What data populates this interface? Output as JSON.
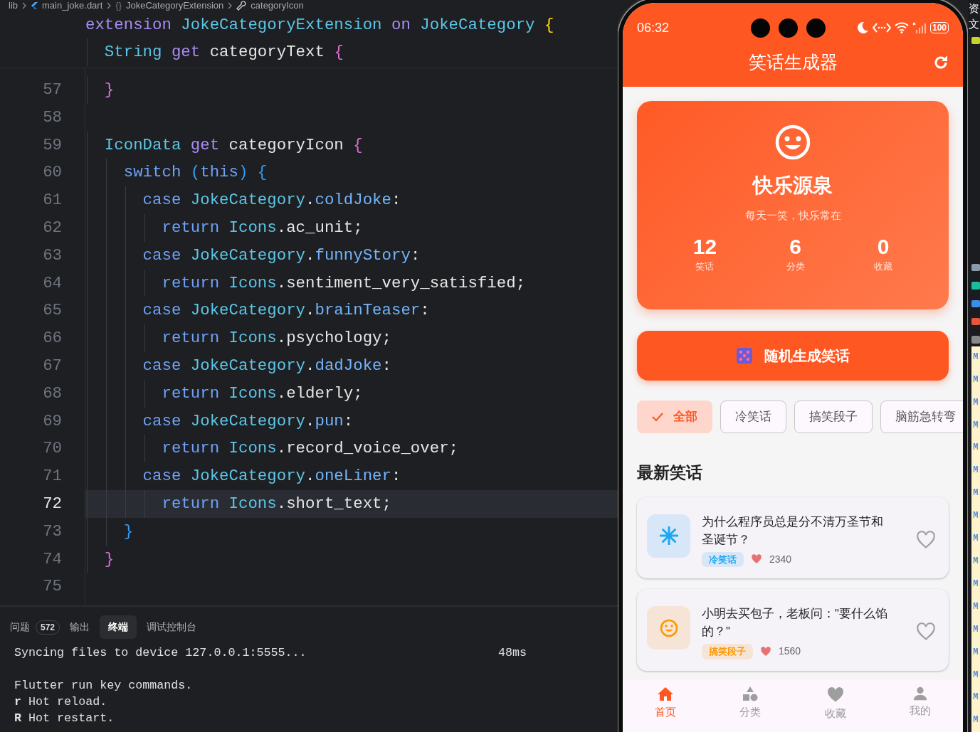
{
  "breadcrumb": [
    {
      "label": "lib"
    },
    {
      "label": "main_joke.dart"
    },
    {
      "label": "JokeCategoryExtension",
      "symbol": "{}"
    },
    {
      "label": "categoryIcon"
    }
  ],
  "sticky_lines": [
    {
      "tokens": [
        {
          "t": "extension",
          "kind": "kw"
        },
        {
          "t": " JokeCategoryExtension ",
          "kind": "type"
        },
        {
          "t": "on",
          "kind": "kw"
        },
        {
          "t": " JokeCategory ",
          "kind": "type"
        },
        {
          "t": "{",
          "kind": "brace1"
        }
      ]
    },
    {
      "tokens": [
        {
          "t": "  String",
          "kind": "type"
        },
        {
          "t": " get",
          "kind": "kw"
        },
        {
          "t": " categoryText ",
          "kind": "ident"
        },
        {
          "t": "{",
          "kind": "brace2"
        }
      ]
    }
  ],
  "code_lines": [
    {
      "number": "57",
      "current": false,
      "tokens": [
        {
          "t": "  }",
          "kind": "brace2"
        }
      ]
    },
    {
      "number": "58",
      "current": false
    },
    {
      "number": "59",
      "current": false,
      "tokens": [
        {
          "t": "  IconData",
          "kind": "type"
        },
        {
          "t": " get",
          "kind": "kw"
        },
        {
          "t": " categoryIcon ",
          "kind": "ident"
        },
        {
          "t": "{",
          "kind": "brace2"
        }
      ]
    },
    {
      "number": "60",
      "current": false,
      "tokens": [
        {
          "t": "    switch ",
          "kind": "ctrl"
        },
        {
          "t": "(",
          "kind": "brace3"
        },
        {
          "t": "this",
          "kind": "ctrl"
        },
        {
          "t": ")",
          "kind": "brace3"
        },
        {
          "t": " {",
          "kind": "brace3"
        }
      ]
    },
    {
      "number": "61",
      "current": false,
      "tokens": [
        {
          "t": "      case",
          "kind": "ctrl"
        },
        {
          "t": " JokeCategory",
          "kind": "type"
        },
        {
          "t": ".",
          "kind": "ident"
        },
        {
          "t": "coldJoke",
          "kind": "prop"
        },
        {
          "t": ":",
          "kind": "ident"
        }
      ]
    },
    {
      "number": "62",
      "current": false,
      "tokens": [
        {
          "t": "        return",
          "kind": "ctrl"
        },
        {
          "t": " Icons",
          "kind": "type"
        },
        {
          "t": ".ac_unit;",
          "kind": "ident"
        }
      ]
    },
    {
      "number": "63",
      "current": false,
      "tokens": [
        {
          "t": "      case",
          "kind": "ctrl"
        },
        {
          "t": " JokeCategory",
          "kind": "type"
        },
        {
          "t": ".",
          "kind": "ident"
        },
        {
          "t": "funnyStory",
          "kind": "prop"
        },
        {
          "t": ":",
          "kind": "ident"
        }
      ]
    },
    {
      "number": "64",
      "current": false,
      "tokens": [
        {
          "t": "        return",
          "kind": "ctrl"
        },
        {
          "t": " Icons",
          "kind": "type"
        },
        {
          "t": ".sentiment_very_satisfied;",
          "kind": "ident"
        }
      ]
    },
    {
      "number": "65",
      "current": false,
      "tokens": [
        {
          "t": "      case",
          "kind": "ctrl"
        },
        {
          "t": " JokeCategory",
          "kind": "type"
        },
        {
          "t": ".",
          "kind": "ident"
        },
        {
          "t": "brainTeaser",
          "kind": "prop"
        },
        {
          "t": ":",
          "kind": "ident"
        }
      ]
    },
    {
      "number": "66",
      "current": false,
      "tokens": [
        {
          "t": "        return",
          "kind": "ctrl"
        },
        {
          "t": " Icons",
          "kind": "type"
        },
        {
          "t": ".psychology;",
          "kind": "ident"
        }
      ]
    },
    {
      "number": "67",
      "current": false,
      "tokens": [
        {
          "t": "      case",
          "kind": "ctrl"
        },
        {
          "t": " JokeCategory",
          "kind": "type"
        },
        {
          "t": ".",
          "kind": "ident"
        },
        {
          "t": "dadJoke",
          "kind": "prop"
        },
        {
          "t": ":",
          "kind": "ident"
        }
      ]
    },
    {
      "number": "68",
      "current": false,
      "tokens": [
        {
          "t": "        return",
          "kind": "ctrl"
        },
        {
          "t": " Icons",
          "kind": "type"
        },
        {
          "t": ".elderly;",
          "kind": "ident"
        }
      ]
    },
    {
      "number": "69",
      "current": false,
      "tokens": [
        {
          "t": "      case",
          "kind": "ctrl"
        },
        {
          "t": " JokeCategory",
          "kind": "type"
        },
        {
          "t": ".",
          "kind": "ident"
        },
        {
          "t": "pun",
          "kind": "prop"
        },
        {
          "t": ":",
          "kind": "ident"
        }
      ]
    },
    {
      "number": "70",
      "current": false,
      "tokens": [
        {
          "t": "        return",
          "kind": "ctrl"
        },
        {
          "t": " Icons",
          "kind": "type"
        },
        {
          "t": ".record_voice_over;",
          "kind": "ident"
        }
      ]
    },
    {
      "number": "71",
      "current": false,
      "tokens": [
        {
          "t": "      case",
          "kind": "ctrl"
        },
        {
          "t": " JokeCategory",
          "kind": "type"
        },
        {
          "t": ".",
          "kind": "ident"
        },
        {
          "t": "oneLiner",
          "kind": "prop"
        },
        {
          "t": ":",
          "kind": "ident"
        }
      ]
    },
    {
      "number": "72",
      "current": true,
      "tokens": [
        {
          "t": "        return",
          "kind": "ctrl"
        },
        {
          "t": " Icons",
          "kind": "type"
        },
        {
          "t": ".short_text;",
          "kind": "ident"
        }
      ]
    },
    {
      "number": "73",
      "current": false,
      "tokens": [
        {
          "t": "    }",
          "kind": "brace3"
        }
      ]
    },
    {
      "number": "74",
      "current": false,
      "tokens": [
        {
          "t": "  }",
          "kind": "brace2"
        }
      ]
    },
    {
      "number": "75",
      "current": false
    }
  ],
  "panel": {
    "tabs": [
      {
        "label": "问题",
        "badge": "572",
        "selected": false
      },
      {
        "label": "输出",
        "selected": false
      },
      {
        "label": "终端",
        "selected": true
      },
      {
        "label": "调试控制台",
        "selected": false
      }
    ],
    "terminal": [
      [
        {
          "text": "Syncing files to device 127.0.0.1:5555...",
          "time": "48ms"
        }
      ],
      [
        {
          "text": "Flutter run key commands."
        },
        {
          "text": "**r** Hot reload."
        },
        {
          "text": "**R** Hot restart."
        }
      ]
    ]
  },
  "phone": {
    "status_bar": {
      "time": "06:32",
      "battery": "100"
    },
    "app_bar": {
      "title": "笑话生成器"
    },
    "hero": {
      "title": "快乐源泉",
      "subtitle": "每天一笑，快乐常在",
      "stats": [
        {
          "value": "12",
          "label": "笑话"
        },
        {
          "value": "6",
          "label": "分类"
        },
        {
          "value": "0",
          "label": "收藏"
        }
      ]
    },
    "random_button": {
      "label": "随机生成笑话"
    },
    "chips": [
      {
        "label": "全部",
        "selected": true
      },
      {
        "label": "冷笑话",
        "selected": false
      },
      {
        "label": "搞笑段子",
        "selected": false
      },
      {
        "label": "脑筋急转弯",
        "selected": false
      }
    ],
    "section_title": "最新笑话",
    "jokes": [
      {
        "kind": "cold",
        "text": "为什么程序员总是分不清万圣节和圣诞节？",
        "tag": "冷笑话",
        "color": "#1ea7f2",
        "likes": "2340",
        "favorite": false
      },
      {
        "kind": "funny",
        "text": "小明去买包子，老板问：\"要什么馅的？\"",
        "tag": "搞笑段子",
        "color": "#ff9800",
        "likes": "1560",
        "favorite": false
      }
    ],
    "bottom_nav": [
      {
        "label": "首页",
        "selected": true
      },
      {
        "label": "分类",
        "selected": false
      },
      {
        "label": "收藏",
        "selected": false
      },
      {
        "label": "我的",
        "selected": false
      }
    ]
  },
  "explorer_strip": {
    "labels": [
      "资",
      "文"
    ],
    "markers": [
      "M",
      "M",
      "M",
      "M",
      "M",
      "M",
      "M",
      "M",
      "M",
      "M",
      "M",
      "M",
      "M",
      "M",
      "M",
      "M",
      "M"
    ]
  }
}
